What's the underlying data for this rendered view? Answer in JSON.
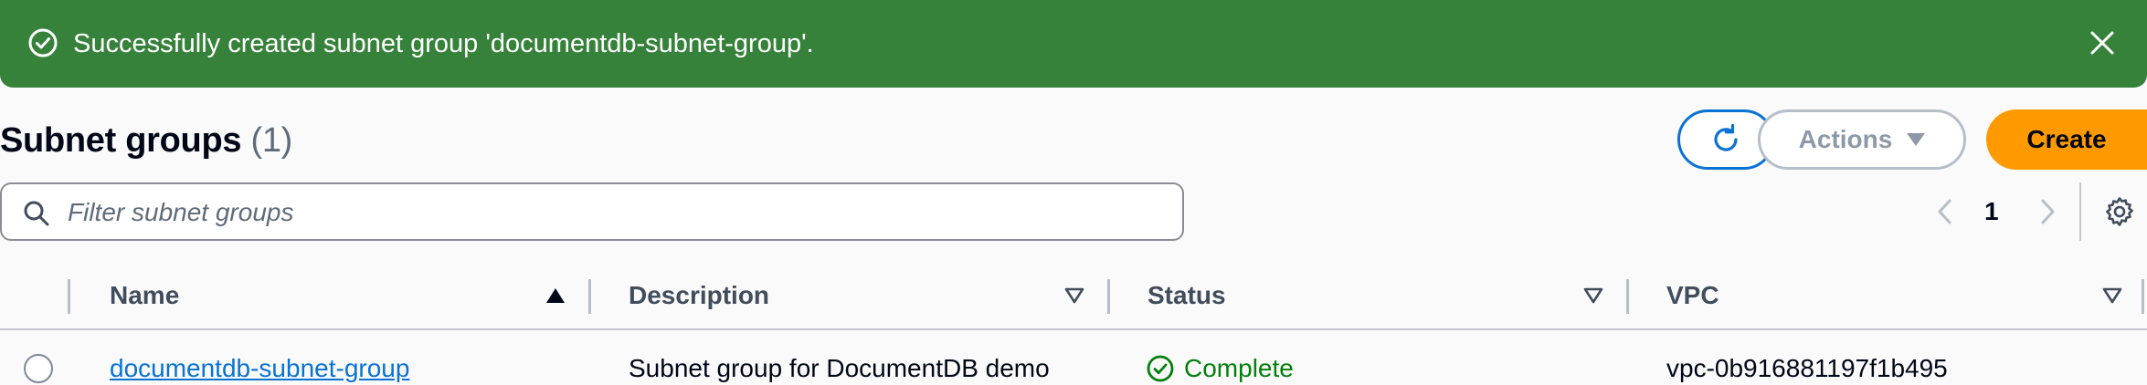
{
  "flash": {
    "message": "Successfully created subnet group 'documentdb-subnet-group'.",
    "icon": "check-circle-icon",
    "close_icon": "close-icon",
    "color": "#37823b"
  },
  "header": {
    "title": "Subnet groups",
    "count": "(1)",
    "actions_label": "Actions",
    "create_label": "Create"
  },
  "filter": {
    "placeholder": "Filter subnet groups",
    "value": ""
  },
  "pagination": {
    "current_page": "1"
  },
  "table": {
    "columns": [
      "Name",
      "Description",
      "Status",
      "VPC"
    ],
    "rows": [
      {
        "name": "documentdb-subnet-group",
        "description": "Subnet group for DocumentDB demo",
        "status": "Complete",
        "vpc": "vpc-0b916881197f1b495"
      }
    ]
  },
  "colors": {
    "primary": "#0972d3",
    "accent": "#ff9900",
    "success": "#037f0c"
  }
}
